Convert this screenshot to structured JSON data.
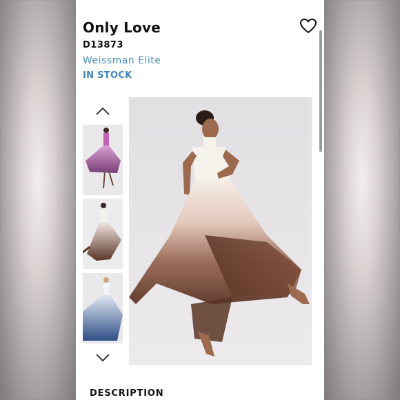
{
  "product": {
    "title": "Only Love",
    "sku": "D13873",
    "brand": "Weissman Elite",
    "stock_status": "IN STOCK"
  },
  "gallery": {
    "thumbnails": [
      {
        "label": "plum-ombre-dress-thumbnail"
      },
      {
        "label": "mocha-ombre-dress-thumbnail"
      },
      {
        "label": "blue-ombre-dress-thumbnail"
      }
    ]
  },
  "sections": {
    "description_label": "DESCRIPTION"
  },
  "icons": {
    "favorite": "heart-icon",
    "scroll_up": "chevron-up-icon",
    "scroll_down": "chevron-down-icon"
  },
  "colors": {
    "brand_link": "#4a8fb9",
    "stock": "#3c85b7"
  }
}
